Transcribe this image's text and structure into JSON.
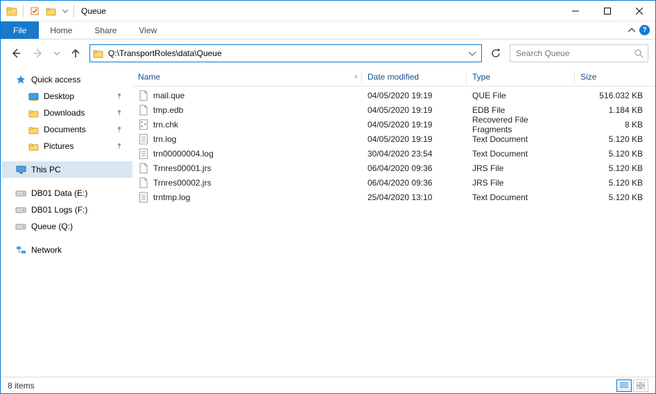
{
  "window": {
    "title": "Queue"
  },
  "ribbon": {
    "file": "File",
    "tabs": [
      "Home",
      "Share",
      "View"
    ]
  },
  "address": {
    "path": "Q:\\TransportRoles\\data\\Queue"
  },
  "search": {
    "placeholder": "Search Queue"
  },
  "sidebar": {
    "quick_access_label": "Quick access",
    "quick": [
      {
        "label": "Desktop",
        "pinned": true
      },
      {
        "label": "Downloads",
        "pinned": true
      },
      {
        "label": "Documents",
        "pinned": true
      },
      {
        "label": "Pictures",
        "pinned": true
      }
    ],
    "this_pc_label": "This PC",
    "drives": [
      {
        "label": "DB01 Data (E:)"
      },
      {
        "label": "DB01 Logs (F:)"
      },
      {
        "label": "Queue (Q:)"
      }
    ],
    "network_label": "Network"
  },
  "columns": {
    "name": "Name",
    "date": "Date modified",
    "type": "Type",
    "size": "Size"
  },
  "files": [
    {
      "name": "mail.que",
      "date": "04/05/2020 19:19",
      "type": "QUE File",
      "size": "516.032 KB",
      "icon": "generic"
    },
    {
      "name": "tmp.edb",
      "date": "04/05/2020 19:19",
      "type": "EDB File",
      "size": "1.184 KB",
      "icon": "generic"
    },
    {
      "name": "trn.chk",
      "date": "04/05/2020 19:19",
      "type": "Recovered File Fragments",
      "size": "8 KB",
      "icon": "chk"
    },
    {
      "name": "trn.log",
      "date": "04/05/2020 19:19",
      "type": "Text Document",
      "size": "5.120 KB",
      "icon": "text"
    },
    {
      "name": "trn00000004.log",
      "date": "30/04/2020 23:54",
      "type": "Text Document",
      "size": "5.120 KB",
      "icon": "text"
    },
    {
      "name": "Trnres00001.jrs",
      "date": "06/04/2020 09:36",
      "type": "JRS File",
      "size": "5.120 KB",
      "icon": "generic"
    },
    {
      "name": "Trnres00002.jrs",
      "date": "06/04/2020 09:36",
      "type": "JRS File",
      "size": "5.120 KB",
      "icon": "generic"
    },
    {
      "name": "trntmp.log",
      "date": "25/04/2020 13:10",
      "type": "Text Document",
      "size": "5.120 KB",
      "icon": "text"
    }
  ],
  "status": {
    "count_text": "8 items"
  }
}
